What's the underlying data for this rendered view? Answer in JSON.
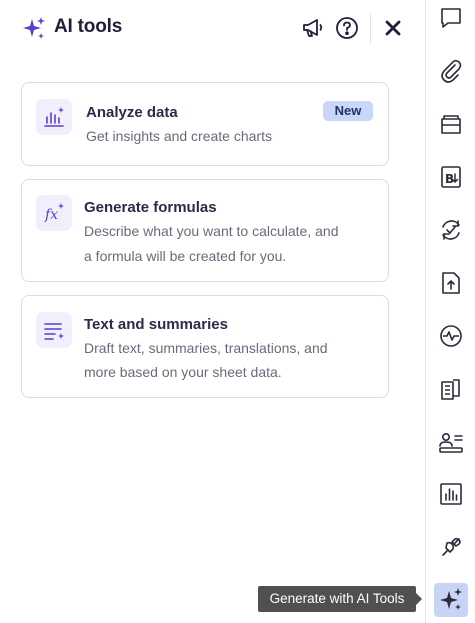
{
  "header": {
    "title": "AI tools",
    "icons": [
      "sparkles-icon",
      "megaphone-icon",
      "help-icon",
      "close-icon"
    ]
  },
  "cards": [
    {
      "icon": "chart-sparkle-icon",
      "title": "Analyze data",
      "badge": "New",
      "description": "Get insights and create charts"
    },
    {
      "icon": "formula-icon",
      "title": "Generate formulas",
      "description_line1": "Describe what you want to calculate, and",
      "description_line2": "a formula will be created for you."
    },
    {
      "icon": "text-sparkle-icon",
      "title": "Text and summaries",
      "description_line1": "Draft text, summaries, translations, and",
      "description_line2": "more based on your sheet data."
    }
  ],
  "rail": {
    "items": [
      "comments-icon",
      "attachments-icon",
      "wallet-icon",
      "brandfolder-icon",
      "refresh-check-icon",
      "upload-file-icon",
      "activity-icon",
      "reports-icon",
      "contacts-icon",
      "bar-chart-icon",
      "connector-icon",
      "ai-tools-icon"
    ],
    "active": "ai-tools-icon"
  },
  "tooltip": {
    "text": "Generate with AI Tools"
  },
  "colors": {
    "accent": "#5b3fd0",
    "badge_bg": "#c8d6f7",
    "icon_bg": "#f1effb",
    "active_rail_bg": "#c7d4f6",
    "tooltip_bg": "#505050"
  }
}
